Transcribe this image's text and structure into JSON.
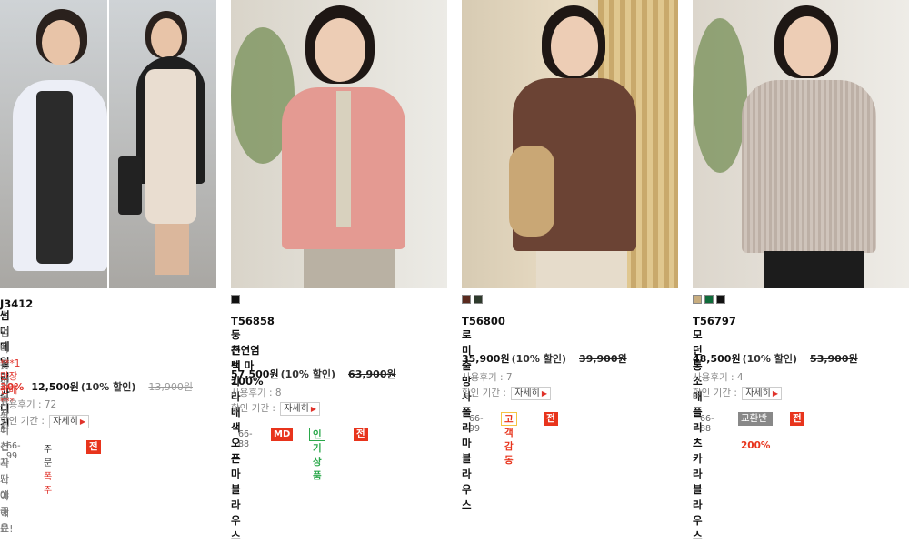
{
  "products": [
    {
      "code": "J3412",
      "name": "썸머 데일리 가디건",
      "subtext": [
        "엄마옷선물로 이건꼭 사야해요!",
        "시원하고 자외선차단에 좋은"
      ],
      "highlight": "***1만장판매***",
      "rate": "30%",
      "price": "12,500원",
      "discount": "(10% 할인)",
      "original": "13,900원",
      "review_label": "사용후기 : 72",
      "period_label": "할인 기간 :",
      "detail_label": "자세히",
      "size": "66-99",
      "order_text": "주문",
      "order_hot": "폭주",
      "badges": [
        "전상품 할인"
      ]
    },
    {
      "code": "T56858",
      "name": "둥근넥 카라배색 오픈 마블라우스",
      "name2": "천연염색 마100%",
      "price": "57,500원",
      "discount": "(10% 할인)",
      "original": "63,900원",
      "review_label": "사용후기 : 8",
      "period_label": "할인 기간 :",
      "detail_label": "자세히",
      "size": "66-88",
      "swatches": [
        "#111111"
      ],
      "badges": [
        "MD추천",
        "인기상품",
        "전상품 할인"
      ]
    },
    {
      "code": "T56800",
      "name": "로미 줄망사 폴리마 블라우스",
      "price": "35,900원",
      "discount": "(10% 할인)",
      "original": "39,900원",
      "review_label": "사용후기 : 7",
      "period_label": "할인 기간 :",
      "detail_label": "자세히",
      "size": "66-99",
      "swatches": [
        "#5a2a1e",
        "#2e3a2c"
      ],
      "badges": [
        "고객감동",
        "전상품 할인"
      ]
    },
    {
      "code": "T56797",
      "name": "모던통소매 플리츠 카라블라우스",
      "price": "48,500원",
      "discount": "(10% 할인)",
      "original": "53,900원",
      "review_label": "사용후기 : 4",
      "period_label": "할인 기간 :",
      "detail_label": "자세히",
      "size": "66-88",
      "swatches": [
        "#c8ad7f",
        "#0f6b3a",
        "#111111"
      ],
      "return_text": "교환반품",
      "return_pct": "200%",
      "badges": [
        "전상품 할인"
      ]
    }
  ],
  "colors": {
    "accent": "#e8341c",
    "sale": "#e0322a"
  }
}
